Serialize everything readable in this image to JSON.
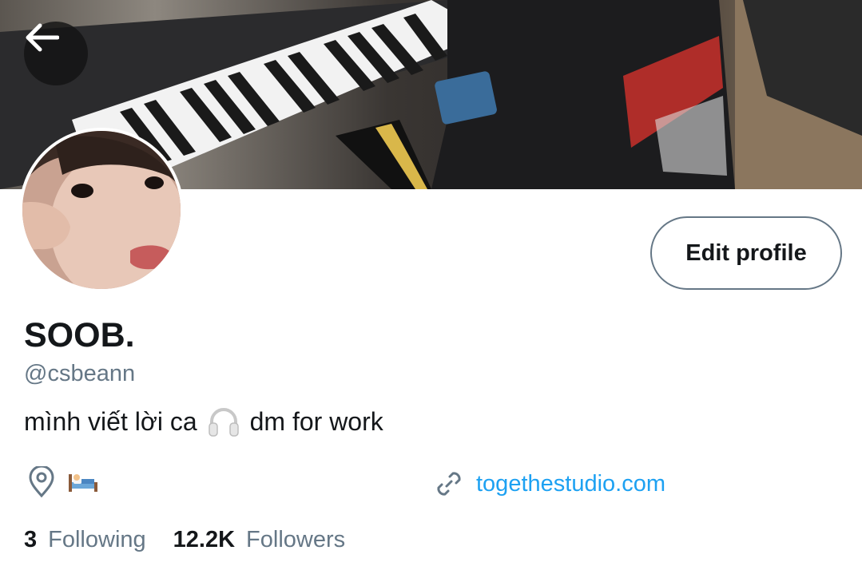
{
  "header": {
    "back_icon": "arrow-left-icon",
    "banner_image": "banner-photo",
    "avatar_image": "avatar-photo"
  },
  "profile": {
    "edit_label": "Edit profile",
    "name": "SOOB.",
    "handle": "@csbeann",
    "bio_before": "mình viết lời ca",
    "bio_emoji_icon": "headphones-icon",
    "bio_after": "dm for work",
    "location_icon": "location-pin-icon",
    "location_emoji_icon": "bed-icon",
    "link_icon": "link-icon",
    "website": "togethestudio.com"
  },
  "stats": {
    "following_count": "3",
    "following_label": "Following",
    "followers_count": "12.2K",
    "followers_label": "Followers"
  },
  "colors": {
    "accent": "#1da1f2",
    "secondary_text": "#657786",
    "primary_text": "#14171a",
    "border": "#657786"
  }
}
